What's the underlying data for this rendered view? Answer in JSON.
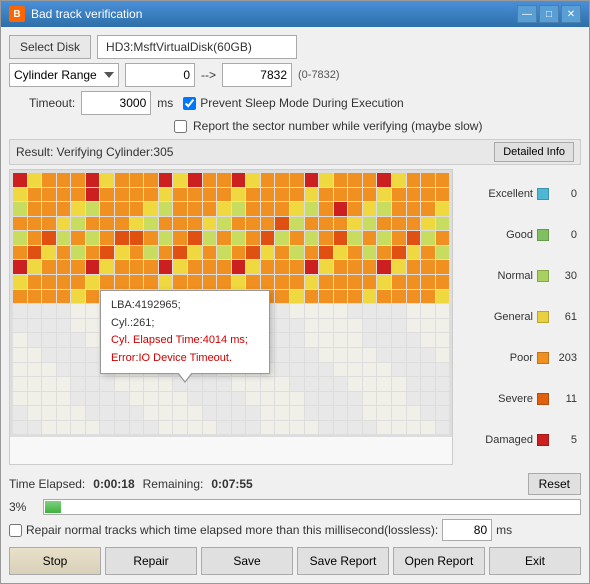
{
  "window": {
    "title": "Bad track verification",
    "icon": "B"
  },
  "header": {
    "select_disk_label": "Select Disk",
    "disk_name": "HD3:MsftVirtualDisk(60GB)"
  },
  "cylinder_range": {
    "dropdown_value": "Cylinder Range",
    "range_start": "0",
    "range_end": "7832",
    "range_hint": "(0-7832)"
  },
  "timeout": {
    "label": "Timeout:",
    "value": "3000",
    "unit": "ms"
  },
  "checkboxes": {
    "prevent_sleep": {
      "label": "Prevent Sleep Mode During Execution",
      "checked": true
    },
    "report_sector": {
      "label": "Report the sector number while verifying (maybe slow)",
      "checked": false
    }
  },
  "result": {
    "text": "Result: Verifying Cylinder:305",
    "detailed_btn": "Detailed Info"
  },
  "tooltip": {
    "lba": "LBA:4192965;",
    "cyl": "Cyl.:261;",
    "elapsed": "Cyl. Elapsed Time:4014 ms;",
    "error": "Error:IO Device Timeout."
  },
  "legend": {
    "items": [
      {
        "name": "Excellent",
        "color": "#4db8d4",
        "count": "0"
      },
      {
        "name": "Good",
        "color": "#80c060",
        "count": "0"
      },
      {
        "name": "Normal",
        "color": "#a8d060",
        "count": "30"
      },
      {
        "name": "General",
        "color": "#e8d040",
        "count": "61"
      },
      {
        "name": "Poor",
        "color": "#f09020",
        "count": "203"
      },
      {
        "name": "Severe",
        "color": "#e06010",
        "count": "11"
      },
      {
        "name": "Damaged",
        "color": "#cc2020",
        "count": "5"
      }
    ]
  },
  "time": {
    "elapsed_label": "Time Elapsed:",
    "elapsed_value": "0:00:18",
    "remaining_label": "Remaining:",
    "remaining_value": "0:07:55",
    "reset_btn": "Reset"
  },
  "progress": {
    "percent": "3%",
    "bar_width": "3"
  },
  "repair": {
    "checkbox_label": "Repair normal tracks which time elapsed more than this millisecond(lossless):",
    "checked": false,
    "value": "80",
    "unit": "ms"
  },
  "actions": {
    "stop": "Stop",
    "repair": "Repair",
    "save": "Save",
    "save_report": "Save Report",
    "open_report": "Open Report",
    "exit": "Exit"
  },
  "grid": {
    "colors": {
      "excellent": "#4db8d4",
      "good": "#80c060",
      "normal": "#c8dc60",
      "general": "#f0d840",
      "poor": "#f09020",
      "severe": "#e05010",
      "damaged": "#cc2020",
      "empty": "#e8e8e8",
      "light": "#f0f0e8"
    }
  }
}
